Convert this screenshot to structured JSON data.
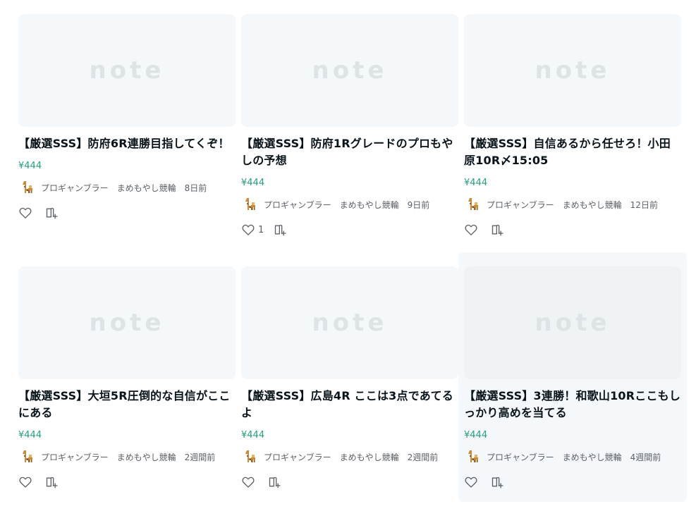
{
  "wordmark": "note",
  "cards": [
    {
      "title": "【厳選SSS】防府6R連勝目指してくぞ！",
      "price": "¥444",
      "creator": "プロギャンブラー",
      "circle": "まめもやし競輪",
      "time": "8日前",
      "likes": ""
    },
    {
      "title": "【厳選SSS】防府1Rグレードのプロもやしの予想",
      "price": "¥444",
      "creator": "プロギャンブラー",
      "circle": "まめもやし競輪",
      "time": "9日前",
      "likes": "1"
    },
    {
      "title": "【厳選SSS】自信あるから任せろ！小田原10R〆15:05",
      "price": "¥444",
      "creator": "プロギャンブラー",
      "circle": "まめもやし競輪",
      "time": "12日前",
      "likes": ""
    },
    {
      "title": "【厳選SSS】大垣5R圧倒的な自信がここにある",
      "price": "¥444",
      "creator": "プロギャンブラー",
      "circle": "まめもやし競輪",
      "time": "2週間前",
      "likes": ""
    },
    {
      "title": "【厳選SSS】広島4R ここは3点であてるよ",
      "price": "¥444",
      "creator": "プロギャンブラー",
      "circle": "まめもやし競輪",
      "time": "2週間前",
      "likes": ""
    },
    {
      "title": "【厳選SSS】3連勝！和歌山10Rここもしっかり高めを当てる",
      "price": "¥444",
      "creator": "プロギャンブラー",
      "circle": "まめもやし競輪",
      "time": "4週間前",
      "likes": ""
    }
  ],
  "icons": {
    "like": "heart-icon",
    "magazine": "magazine-add-icon",
    "avatar": "giraffe-avatar"
  },
  "colors": {
    "price": "#249f80",
    "thumbnail": "#f5f8fa",
    "hover_card": "#f5f8fa"
  }
}
